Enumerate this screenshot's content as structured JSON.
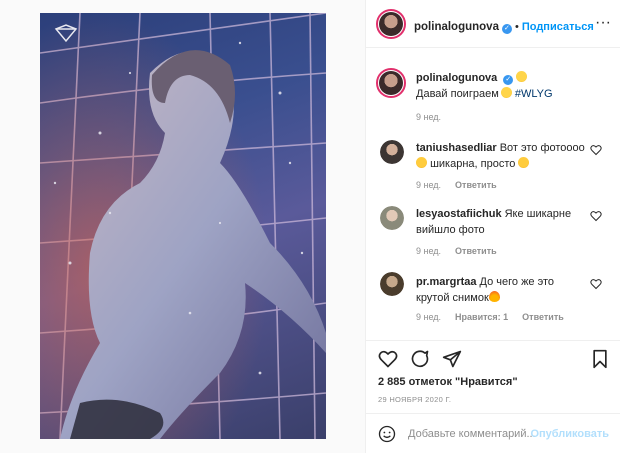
{
  "post": {
    "photo_alt_icon": "brand-logo-icon",
    "accent_color": "#0095f6"
  },
  "header": {
    "username": "polinalogunova",
    "dot": "•",
    "follow_label": "Подписаться",
    "more_label": "···"
  },
  "caption": {
    "username": "polinalogunova",
    "line1_emoji": "grinning-face-emoji",
    "text": "Давай поиграем",
    "hashtag": "#WLYG",
    "time": "9 нед."
  },
  "comments": [
    {
      "username": "taniushasedliar",
      "text_a": "Вот это фотоооо",
      "text_b": "шикарна, просто",
      "time": "9 нед.",
      "reply": "Ответить"
    },
    {
      "username": "lesyaostafiichuk",
      "text_a": "Яке шикарне",
      "text_b": "вийшло фото",
      "time": "9 нед.",
      "reply": "Ответить"
    },
    {
      "username": "pr.margrtaa",
      "text_a": "До чего же это",
      "text_b": "крутой снимок",
      "time": "9 нед.",
      "likes": "Нравится: 1",
      "reply": "Ответить"
    }
  ],
  "actions": {
    "likes": "2 885 отметок \"Нравится\"",
    "date": "29 НОЯБРЯ 2020 Г."
  },
  "add_comment": {
    "placeholder": "Добавьте комментарий...",
    "publish": "Опубликовать"
  }
}
